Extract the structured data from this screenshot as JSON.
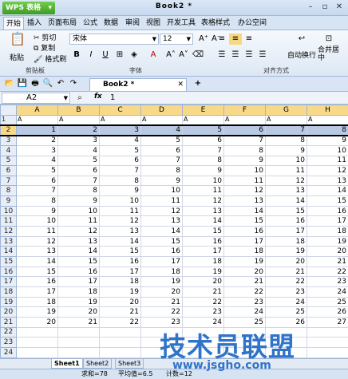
{
  "app": {
    "menu_label": "WPS 表格",
    "menu_arrow": "▾",
    "window_title": "Book2 *"
  },
  "window_controls": [
    "–",
    "▫",
    "✕"
  ],
  "ribbon_tabs": [
    "开始",
    "插入",
    "页面布局",
    "公式",
    "数据",
    "审阅",
    "视图",
    "开发工具",
    "表格样式",
    "办公空间"
  ],
  "ribbon": {
    "paste": "粘贴",
    "cut": "剪切",
    "copy": "复制",
    "format_painter": "格式刷",
    "clipboard_group": "剪贴板",
    "font_name": "宋体",
    "font_size": "12",
    "font_group": "字体",
    "bold": "B",
    "italic": "I",
    "underline": "U",
    "wrap_text": "自动换行",
    "merge_center": "合并居中",
    "alignment_group": "对齐方式"
  },
  "document_tab": "Book2 *",
  "formula_bar": {
    "cell_ref": "A2",
    "fx": "fx",
    "value": "1"
  },
  "grid": {
    "columns": [
      "A",
      "B",
      "C",
      "D",
      "E",
      "F",
      "G",
      "H"
    ],
    "header_row_text": "A",
    "rows": [
      [
        "1",
        "2",
        "3",
        "4",
        "5",
        "6",
        "7",
        "8"
      ],
      [
        "2",
        "3",
        "4",
        "5",
        "6",
        "7",
        "8",
        "9"
      ],
      [
        "3",
        "4",
        "5",
        "6",
        "7",
        "8",
        "9",
        "10"
      ],
      [
        "4",
        "5",
        "6",
        "7",
        "8",
        "9",
        "10",
        "11"
      ],
      [
        "5",
        "6",
        "7",
        "8",
        "9",
        "10",
        "11",
        "12"
      ],
      [
        "6",
        "7",
        "8",
        "9",
        "10",
        "11",
        "12",
        "13"
      ],
      [
        "7",
        "8",
        "9",
        "10",
        "11",
        "12",
        "13",
        "14"
      ],
      [
        "8",
        "9",
        "10",
        "11",
        "12",
        "13",
        "14",
        "15"
      ],
      [
        "9",
        "10",
        "11",
        "12",
        "13",
        "14",
        "15",
        "16"
      ],
      [
        "10",
        "11",
        "12",
        "13",
        "14",
        "15",
        "16",
        "17"
      ],
      [
        "11",
        "12",
        "13",
        "14",
        "15",
        "16",
        "17",
        "18"
      ],
      [
        "12",
        "13",
        "14",
        "15",
        "16",
        "17",
        "18",
        "19"
      ],
      [
        "13",
        "14",
        "15",
        "16",
        "17",
        "18",
        "19",
        "20"
      ],
      [
        "14",
        "15",
        "16",
        "17",
        "18",
        "19",
        "20",
        "21"
      ],
      [
        "15",
        "16",
        "17",
        "18",
        "19",
        "20",
        "21",
        "22"
      ],
      [
        "16",
        "17",
        "18",
        "19",
        "20",
        "21",
        "22",
        "23"
      ],
      [
        "17",
        "18",
        "19",
        "20",
        "21",
        "22",
        "23",
        "24"
      ],
      [
        "18",
        "19",
        "20",
        "21",
        "22",
        "23",
        "24",
        "25"
      ],
      [
        "19",
        "20",
        "21",
        "22",
        "23",
        "24",
        "25",
        "26"
      ],
      [
        "20",
        "21",
        "22",
        "23",
        "24",
        "25",
        "26",
        "27"
      ]
    ],
    "row_count": 24
  },
  "sheets": [
    "Sheet1",
    "Sheet2",
    "Sheet3"
  ],
  "status": {
    "sum": "求和=78",
    "average": "平均值=6.5",
    "count": "计数=12"
  },
  "watermark": {
    "text": "技术员联盟",
    "url": "www.jsgho.com"
  }
}
